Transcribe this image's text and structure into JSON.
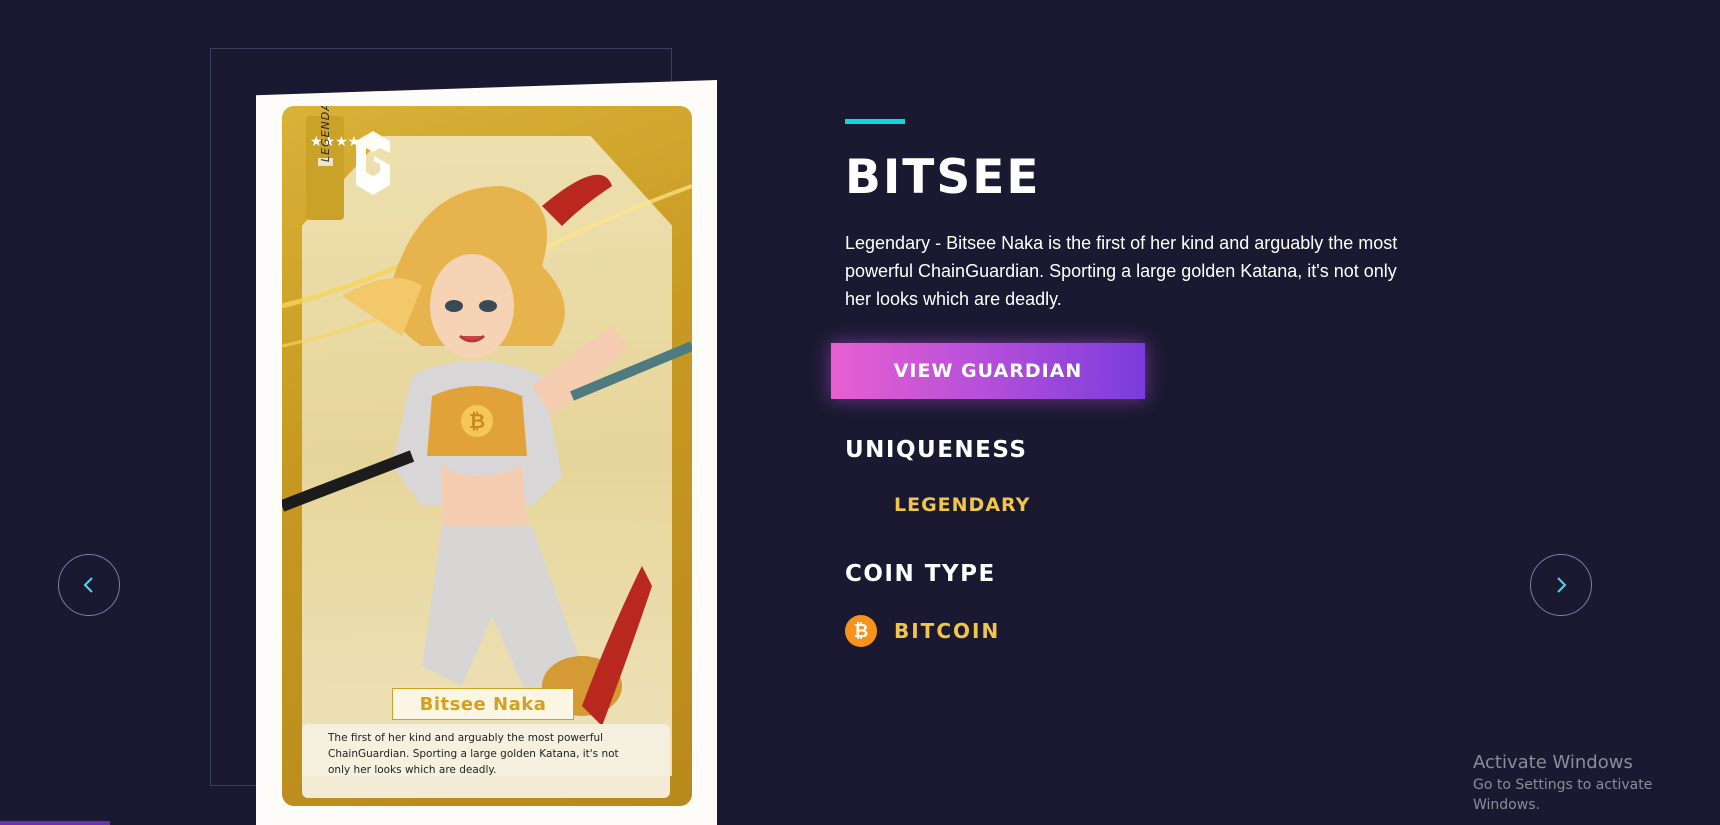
{
  "guardian": {
    "name": "BITSEE",
    "description": "Legendary - Bitsee Naka is the first of her kind and arguably the most powerful ChainGuardian. Sporting a large golden Katana, it's not only her looks which are deadly.",
    "view_button_label": "VIEW GUARDIAN",
    "uniqueness_heading": "UNIQUENESS",
    "uniqueness_value": "LEGENDARY",
    "coin_type_heading": "COIN TYPE",
    "coin_type_value": "BITCOIN",
    "coin_icon": "bitcoin-icon",
    "coin_symbol": "₿"
  },
  "card": {
    "rarity_label": "LEGENDARY",
    "stars": "★★★★",
    "name": "Bitsee Naka",
    "description": "The first of her kind and arguably the most powerful ChainGuardian. Sporting a large golden Katana, it's not only her looks which are deadly."
  },
  "nav": {
    "prev_icon": "chevron-left-icon",
    "next_icon": "chevron-right-icon"
  },
  "watermark": {
    "title": "Activate Windows",
    "subtitle": "Go to Settings to activate Windows."
  },
  "colors": {
    "background": "#1a1931",
    "accent": "#10d6e0",
    "gold": "#f0c64a",
    "button_start": "#e85fd0",
    "button_end": "#7a3cdc",
    "bitcoin": "#f7931a"
  }
}
